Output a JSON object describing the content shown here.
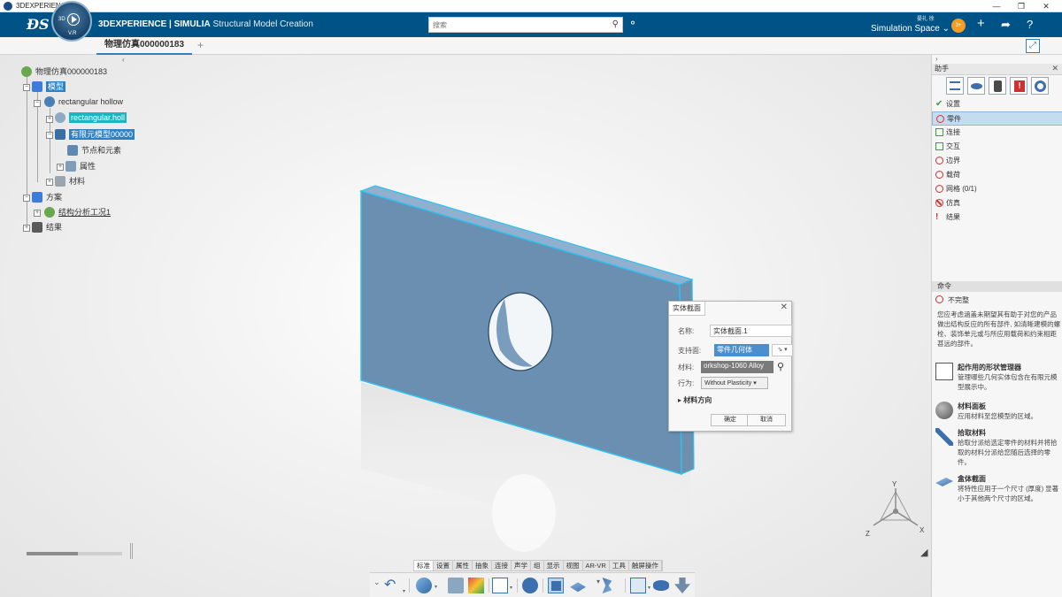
{
  "os_window": {
    "title": "3DEXPERIENCE",
    "controls": [
      "—",
      "❐",
      "✕"
    ]
  },
  "header": {
    "compass": {
      "top_label": "3D",
      "bottom_label": "V.R"
    },
    "brand_bold": "3DEXPERIENCE | SIMULIA",
    "brand_app": "Structural Model Creation",
    "search_placeholder": "搜索",
    "user_name": "晏礼 徐",
    "space": "Simulation Space ⌄",
    "badge": "3+"
  },
  "tabs": {
    "active": "物理仿真000000183",
    "add": "+"
  },
  "tree": {
    "root": "物理仿真000000183",
    "model": "模型",
    "part": "rectangular hollow",
    "part_child": "rectangular.holl",
    "fem": "有限元模型00000",
    "nodes": "节点和元素",
    "properties": "属性",
    "material": "材料",
    "scenario": "方案",
    "case": "结构分析工况1",
    "results": "结果"
  },
  "dialog": {
    "title": "实体截面",
    "name_label": "名称:",
    "name_value": "实体截面.1",
    "support_label": "支持面:",
    "support_value": "零件几何体",
    "support_select": "⇘ ▾",
    "material_label": "材料:",
    "material_value": "orkshop-1060 Alloy",
    "behavior_label": "行为:",
    "behavior_value": "Without Plasticity",
    "orientation": "材料方向",
    "ok": "确定",
    "cancel": "取消"
  },
  "section_tabs": [
    "标准",
    "设置",
    "属性",
    "抽象",
    "连接",
    "声学",
    "组",
    "显示",
    "视图",
    "AR-VR",
    "工具",
    "触屏操作"
  ],
  "section_tabs_active": "标准",
  "axes": {
    "x": "X",
    "y": "Y",
    "z": "Z"
  },
  "assistant": {
    "title": "助手",
    "items": [
      {
        "label": "设置",
        "state": "done"
      },
      {
        "label": "零件",
        "state": "error",
        "selected": true
      },
      {
        "label": "连接",
        "state": "todo"
      },
      {
        "label": "交互",
        "state": "todo"
      },
      {
        "label": "边界",
        "state": "error"
      },
      {
        "label": "载荷",
        "state": "error"
      },
      {
        "label": "网格 (0/1)",
        "state": "error"
      },
      {
        "label": "仿真",
        "state": "blocked"
      },
      {
        "label": "结果",
        "state": "warn"
      }
    ],
    "command_header": "命令",
    "command_status": "不完整",
    "command_desc": "您应考虑涵盖未期望其有助于对您的产品做出结构反应的所有部件, 如清晰建模的螺栓、装饰单元或与所应用载荷和约束相距甚远的部件。",
    "hints": [
      {
        "title": "起作用的形状管理器",
        "desc": "管理哪些几何实体包含在有限元模型展示中。"
      },
      {
        "title": "材料面板",
        "desc": "应用材料至您模型的区域。"
      },
      {
        "title": "拾取材料",
        "desc": "拾取分派给选定零件的材料并将拾取的材料分派给您随后选择的零件。"
      },
      {
        "title": "盒体截面",
        "desc": "将特性应用于一个尺寸 (厚度) 显著小于其他两个尺寸的区域。"
      }
    ]
  },
  "colors": {
    "header": "#005386",
    "accent": "#2f7fc1",
    "plate": "#6a8fb0",
    "edge": "#2fc0f0"
  }
}
